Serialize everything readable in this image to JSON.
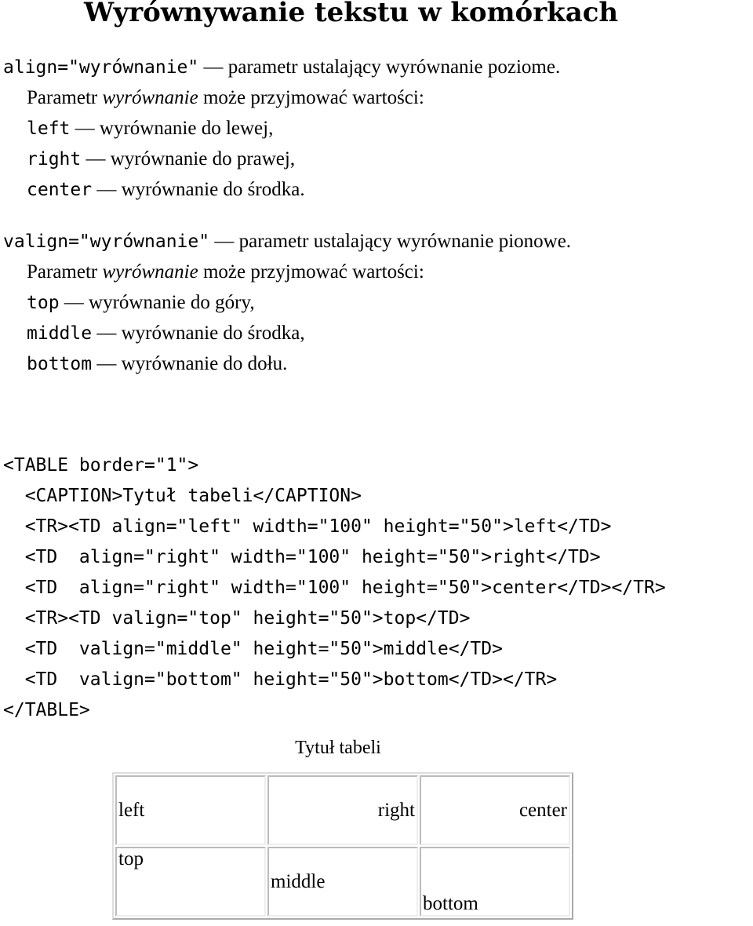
{
  "title": "Wyrównywanie tekstu w komórkach",
  "align": {
    "code": "align=\"wyrównanie\"",
    "desc": " — parametr ustalający wyrównanie poziome.",
    "param_pre": "Parametr ",
    "param_em": "wyrównanie",
    "param_post": " może przyjmować wartości:",
    "values": [
      {
        "code": "left",
        "desc": " — wyrównanie do lewej,"
      },
      {
        "code": "right",
        "desc": " — wyrównanie do prawej,"
      },
      {
        "code": "center",
        "desc": " — wyrównanie do środka."
      }
    ]
  },
  "valign": {
    "code": "valign=\"wyrównanie\"",
    "desc": " — parametr ustalający wyrównanie pionowe.",
    "param_pre": "Parametr ",
    "param_em": "wyrównanie",
    "param_post": " może przyjmować wartości:",
    "values": [
      {
        "code": "top",
        "desc": " — wyrównanie do góry,"
      },
      {
        "code": "middle",
        "desc": " — wyrównanie do środka,"
      },
      {
        "code": "bottom",
        "desc": " — wyrównanie do dołu."
      }
    ]
  },
  "code_lines": [
    "<TABLE border=\"1\">",
    "  <CAPTION>Tytuł tabeli</CAPTION>",
    "  <TR><TD align=\"left\" width=\"100\" height=\"50\">left</TD>",
    "  <TD  align=\"right\" width=\"100\" height=\"50\">right</TD>",
    "  <TD  align=\"right\" width=\"100\" height=\"50\">center</TD></TR>",
    "  <TR><TD valign=\"top\" height=\"50\">top</TD>",
    "  <TD  valign=\"middle\" height=\"50\">middle</TD>",
    "  <TD  valign=\"bottom\" height=\"50\">bottom</TD></TR>",
    "</TABLE>"
  ],
  "demo": {
    "caption": "Tytuł tabeli",
    "rows": [
      [
        "left",
        "right",
        "center"
      ],
      [
        "top",
        "middle",
        "bottom"
      ]
    ]
  }
}
